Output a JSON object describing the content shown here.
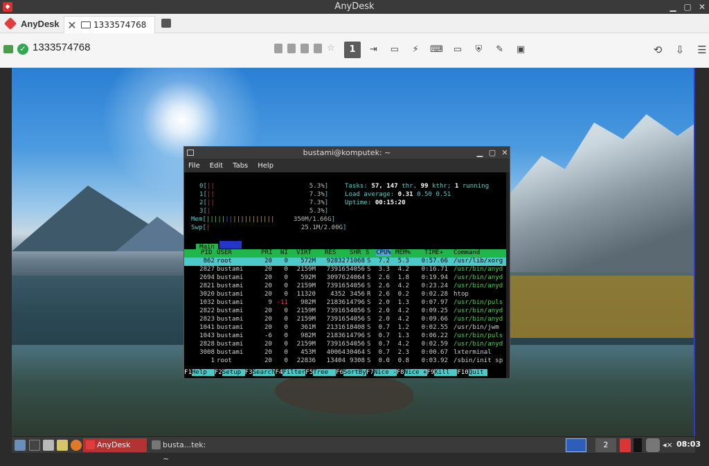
{
  "window": {
    "title": "AnyDesk",
    "minimize_icon": "minimize-icon",
    "maximize_icon": "maximize-icon",
    "close_icon": "close-icon"
  },
  "tabbar": {
    "brand": "AnyDesk",
    "tab_label": "1333574768"
  },
  "address": {
    "value": "1333574768"
  },
  "toolbar": {
    "monitor_number": "1"
  },
  "terminal": {
    "title": "bustami@komputek: ~",
    "menu": [
      "File",
      "Edit",
      "Tabs",
      "Help"
    ],
    "cpus": [
      {
        "id": "0",
        "pct": "5.3%"
      },
      {
        "id": "1",
        "pct": "7.3%"
      },
      {
        "id": "2",
        "pct": "7.3%"
      },
      {
        "id": "3",
        "pct": "5.3%"
      }
    ],
    "mem_label": "Mem",
    "mem_value": "350M/1.66G",
    "swp_label": "Swp",
    "swp_value": "25.1M/2.00G",
    "tasks_label": "Tasks:",
    "tasks_value": "57,",
    "thr_value": "147",
    "thr_label": "thr,",
    "kthr_value": "99",
    "kthr_label": "kthr;",
    "running_value": "1",
    "running_label": "running",
    "load_label": "Load average:",
    "load1": "0.31",
    "load5": "0.50",
    "load15": "0.51",
    "uptime_label": "Uptime:",
    "uptime_value": "00:15:20",
    "tab_main": "Main",
    "columns": {
      "pid": "PID",
      "user": "USER",
      "pri": "PRI",
      "ni": "NI",
      "virt": "VIRT",
      "res": "RES",
      "shr": "SHR",
      "s": "S",
      "cpu": "CPU%",
      "mem": "MEM%",
      "time": "TIME+",
      "command": "Command"
    },
    "processes": [
      {
        "pid": "862",
        "user": "root",
        "pri": "20",
        "ni": "0",
        "virt": "572M",
        "res": "92832",
        "shr": "71068",
        "s": "S",
        "cpu": "7.2",
        "mem": "5.3",
        "time": "0:57.66",
        "command": "/usr/lib/xorg"
      },
      {
        "pid": "2827",
        "user": "bustami",
        "pri": "20",
        "ni": "0",
        "virt": "2159M",
        "res": "73916",
        "shr": "54056",
        "s": "S",
        "cpu": "3.3",
        "mem": "4.2",
        "time": "0:16.71",
        "command": "/usr/bin/anyd"
      },
      {
        "pid": "2694",
        "user": "bustami",
        "pri": "20",
        "ni": "0",
        "virt": "592M",
        "res": "30976",
        "shr": "24064",
        "s": "S",
        "cpu": "2.6",
        "mem": "1.8",
        "time": "0:19.94",
        "command": "/usr/bin/anyd"
      },
      {
        "pid": "2821",
        "user": "bustami",
        "pri": "20",
        "ni": "0",
        "virt": "2159M",
        "res": "73916",
        "shr": "54056",
        "s": "S",
        "cpu": "2.6",
        "mem": "4.2",
        "time": "0:23.24",
        "command": "/usr/bin/anyd"
      },
      {
        "pid": "3020",
        "user": "bustami",
        "pri": "20",
        "ni": "0",
        "virt": "11320",
        "res": "4352",
        "shr": "3456",
        "s": "R",
        "cpu": "2.6",
        "mem": "0.2",
        "time": "0:02.28",
        "command": "htop"
      },
      {
        "pid": "1032",
        "user": "bustami",
        "pri": "9",
        "ni": "-11",
        "virt": "982M",
        "res": "21836",
        "shr": "14796",
        "s": "S",
        "cpu": "2.0",
        "mem": "1.3",
        "time": "0:07.97",
        "command": "/usr/bin/puls"
      },
      {
        "pid": "2822",
        "user": "bustami",
        "pri": "20",
        "ni": "0",
        "virt": "2159M",
        "res": "73916",
        "shr": "54056",
        "s": "S",
        "cpu": "2.0",
        "mem": "4.2",
        "time": "0:09.25",
        "command": "/usr/bin/anyd"
      },
      {
        "pid": "2823",
        "user": "bustami",
        "pri": "20",
        "ni": "0",
        "virt": "2159M",
        "res": "73916",
        "shr": "54056",
        "s": "S",
        "cpu": "2.0",
        "mem": "4.2",
        "time": "0:09.66",
        "command": "/usr/bin/anyd"
      },
      {
        "pid": "1041",
        "user": "bustami",
        "pri": "20",
        "ni": "0",
        "virt": "361M",
        "res": "21316",
        "shr": "18408",
        "s": "S",
        "cpu": "0.7",
        "mem": "1.2",
        "time": "0:02.55",
        "command": "/usr/bin/jwm"
      },
      {
        "pid": "1043",
        "user": "bustami",
        "pri": "-6",
        "ni": "0",
        "virt": "982M",
        "res": "21836",
        "shr": "14796",
        "s": "S",
        "cpu": "0.7",
        "mem": "1.3",
        "time": "0:06.22",
        "command": "/usr/bin/puls"
      },
      {
        "pid": "2828",
        "user": "bustami",
        "pri": "20",
        "ni": "0",
        "virt": "2159M",
        "res": "73916",
        "shr": "54056",
        "s": "S",
        "cpu": "0.7",
        "mem": "4.2",
        "time": "0:02.59",
        "command": "/usr/bin/anyd"
      },
      {
        "pid": "3008",
        "user": "bustami",
        "pri": "20",
        "ni": "0",
        "virt": "453M",
        "res": "40064",
        "shr": "30464",
        "s": "S",
        "cpu": "0.7",
        "mem": "2.3",
        "time": "0:00.67",
        "command": "lxterminal"
      },
      {
        "pid": "1",
        "user": "root",
        "pri": "20",
        "ni": "0",
        "virt": "22836",
        "res": "13404",
        "shr": "9308",
        "s": "S",
        "cpu": "0.0",
        "mem": "0.8",
        "time": "0:03.92",
        "command": "/sbin/init sp"
      }
    ],
    "fkeys": [
      {
        "k": "F1",
        "v": "Help  "
      },
      {
        "k": "F2",
        "v": "Setup "
      },
      {
        "k": "F3",
        "v": "Search"
      },
      {
        "k": "F4",
        "v": "Filter"
      },
      {
        "k": "F5",
        "v": "Tree  "
      },
      {
        "k": "F6",
        "v": "SortBy"
      },
      {
        "k": "F7",
        "v": "Nice -"
      },
      {
        "k": "F8",
        "v": "Nice +"
      },
      {
        "k": "F9",
        "v": "Kill  "
      },
      {
        "k": "F10",
        "v": "Quit "
      }
    ]
  },
  "taskbar": {
    "tasks": [
      "AnyDesk",
      "busta...tek: ~"
    ],
    "workspace": "2",
    "clock": "08:03"
  }
}
